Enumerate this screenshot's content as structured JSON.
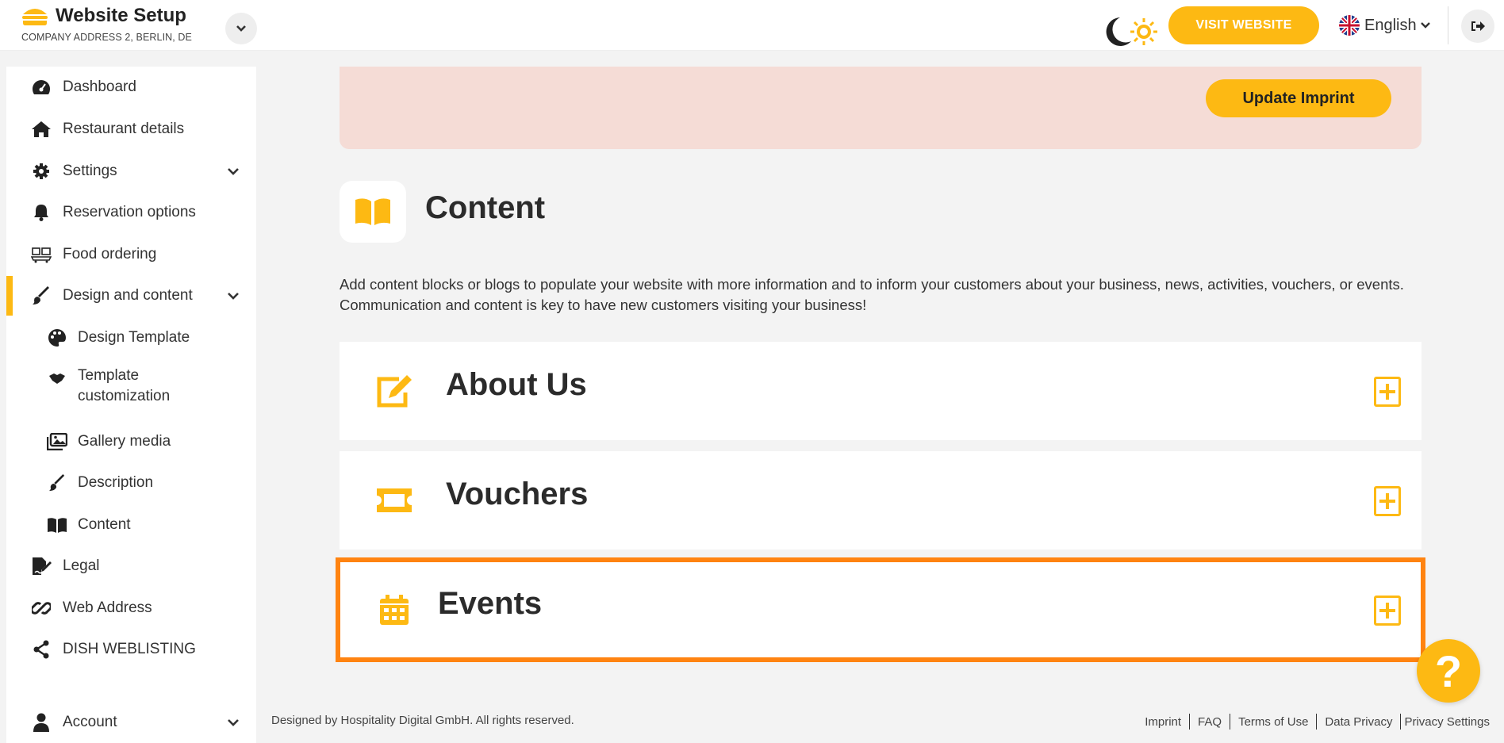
{
  "header": {
    "app_title": "Website Setup",
    "address": "COMPANY ADDRESS 2, BERLIN, DE",
    "visit_label": "VISIT WEBSITE",
    "language": "English"
  },
  "sidebar": {
    "items": [
      {
        "label": "Dashboard"
      },
      {
        "label": "Restaurant details"
      },
      {
        "label": "Settings"
      },
      {
        "label": "Reservation options"
      },
      {
        "label": "Food ordering"
      },
      {
        "label": "Design and content"
      },
      {
        "label": "Design Template"
      },
      {
        "label": "Template customization"
      },
      {
        "label": "Gallery media"
      },
      {
        "label": "Description"
      },
      {
        "label": "Content"
      },
      {
        "label": "Legal"
      },
      {
        "label": "Web Address"
      },
      {
        "label": "DISH WEBLISTING"
      },
      {
        "label": "Account"
      }
    ]
  },
  "main": {
    "update_imprint_label": "Update Imprint",
    "section_title": "Content",
    "description": "Add content blocks or blogs to populate your website with more information and to inform your customers about your business, news, activities, vouchers, or events. Communication and content is key to have new customers visiting your business!",
    "panels": [
      {
        "title": "About Us"
      },
      {
        "title": "Vouchers"
      },
      {
        "title": "Events"
      }
    ]
  },
  "help_label": "?",
  "footer": {
    "copyright": "Designed by Hospitality Digital GmbH. All rights reserved.",
    "links": [
      "Imprint",
      "FAQ",
      "Terms of Use",
      "Data Privacy",
      "Privacy Settings"
    ]
  },
  "colors": {
    "accent": "#fdb913",
    "highlight": "#ff8310",
    "banner": "#f5dcd6"
  }
}
